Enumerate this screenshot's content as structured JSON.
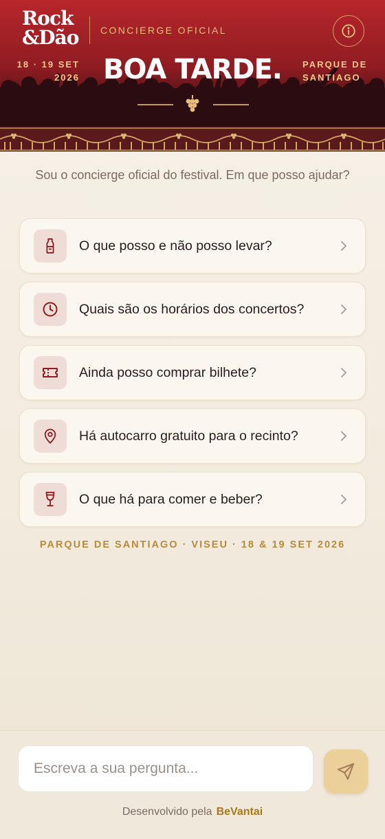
{
  "header": {
    "logo_line1": "Rock",
    "logo_line2": "&Dão",
    "concierge_label": "CONCIERGE OFICIAL",
    "date_line1": "18 · 19 SET",
    "date_line2": "2026",
    "greeting": "BOA TARDE.",
    "place_line1": "PARQUE DE",
    "place_line2": "SANTIAGO",
    "info_icon": "info-icon"
  },
  "intro": "Sou o concierge oficial do festival. Em que posso ajudar?",
  "questions": [
    {
      "label": "O que posso e não posso levar?",
      "icon": "bottle-icon"
    },
    {
      "label": "Quais são os horários dos concertos?",
      "icon": "clock-icon"
    },
    {
      "label": "Ainda posso comprar bilhete?",
      "icon": "ticket-icon"
    },
    {
      "label": "Há autocarro gratuito para o recinto?",
      "icon": "location-pin-icon"
    },
    {
      "label": "O que há para comer e beber?",
      "icon": "wine-glass-icon"
    }
  ],
  "venue_footer": "PARQUE DE SANTIAGO · VISEU · 18 & 19 SET 2026",
  "chat": {
    "placeholder": "Escreva a sua pergunta...",
    "value": "",
    "send_icon": "send-icon"
  },
  "footer": {
    "powered_by": "Desenvolvido pela",
    "brand": "BeVantai"
  },
  "colors": {
    "header_red": "#b7262b",
    "gold": "#e9bd7b",
    "icon_tint": "#8e1c22",
    "card_bg": "#fbf7ef",
    "send_bg": "#ecd09a"
  }
}
